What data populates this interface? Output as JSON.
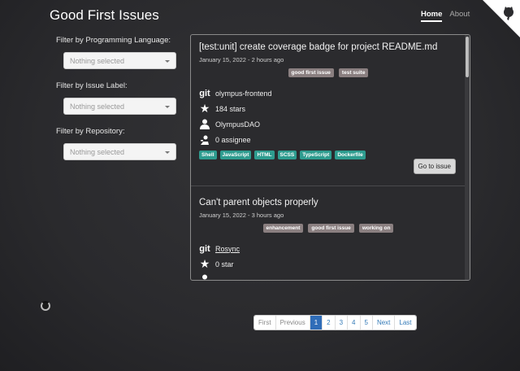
{
  "header": {
    "title": "Good First Issues",
    "nav": [
      {
        "label": "Home",
        "active": true
      },
      {
        "label": "About",
        "active": false
      }
    ]
  },
  "filters": [
    {
      "label": "Filter by Programming Language:",
      "placeholder": "Nothing selected"
    },
    {
      "label": "Filter by Issue Label:",
      "placeholder": "Nothing selected"
    },
    {
      "label": "Filter by Repository:",
      "placeholder": "Nothing selected"
    }
  ],
  "issues": [
    {
      "title": "[test:unit] create coverage badge for project README.md",
      "date": "January 15, 2022 - 2 hours ago",
      "labels": [
        "good first issue",
        "test suite"
      ],
      "repo": "olympus-frontend",
      "stars": "184 stars",
      "owner": "OlympusDAO",
      "assignees": "0 assignee",
      "tags": [
        "Shell",
        "JavaScript",
        "HTML",
        "SCSS",
        "TypeScript",
        "Dockerfile"
      ],
      "button": "Go to issue"
    },
    {
      "title": "Can't parent objects properly",
      "date": "January 15, 2022 - 3 hours ago",
      "labels": [
        "enhancement",
        "good first issue",
        "working on"
      ],
      "repo": "Rosync",
      "stars": "0 star",
      "owner": "",
      "assignees": ""
    }
  ],
  "pagination": {
    "first": "First",
    "previous": "Previous",
    "pages": [
      "1",
      "2",
      "3",
      "4",
      "5"
    ],
    "active_page": "1",
    "next": "Next",
    "last": "Last"
  },
  "icons": {
    "repo": "git-icon",
    "stars": "star-icon",
    "owner": "person-icon",
    "assignee": "assignee-icon",
    "corner": "github-octocat-icon",
    "loading": "loading-spinner-icon"
  }
}
